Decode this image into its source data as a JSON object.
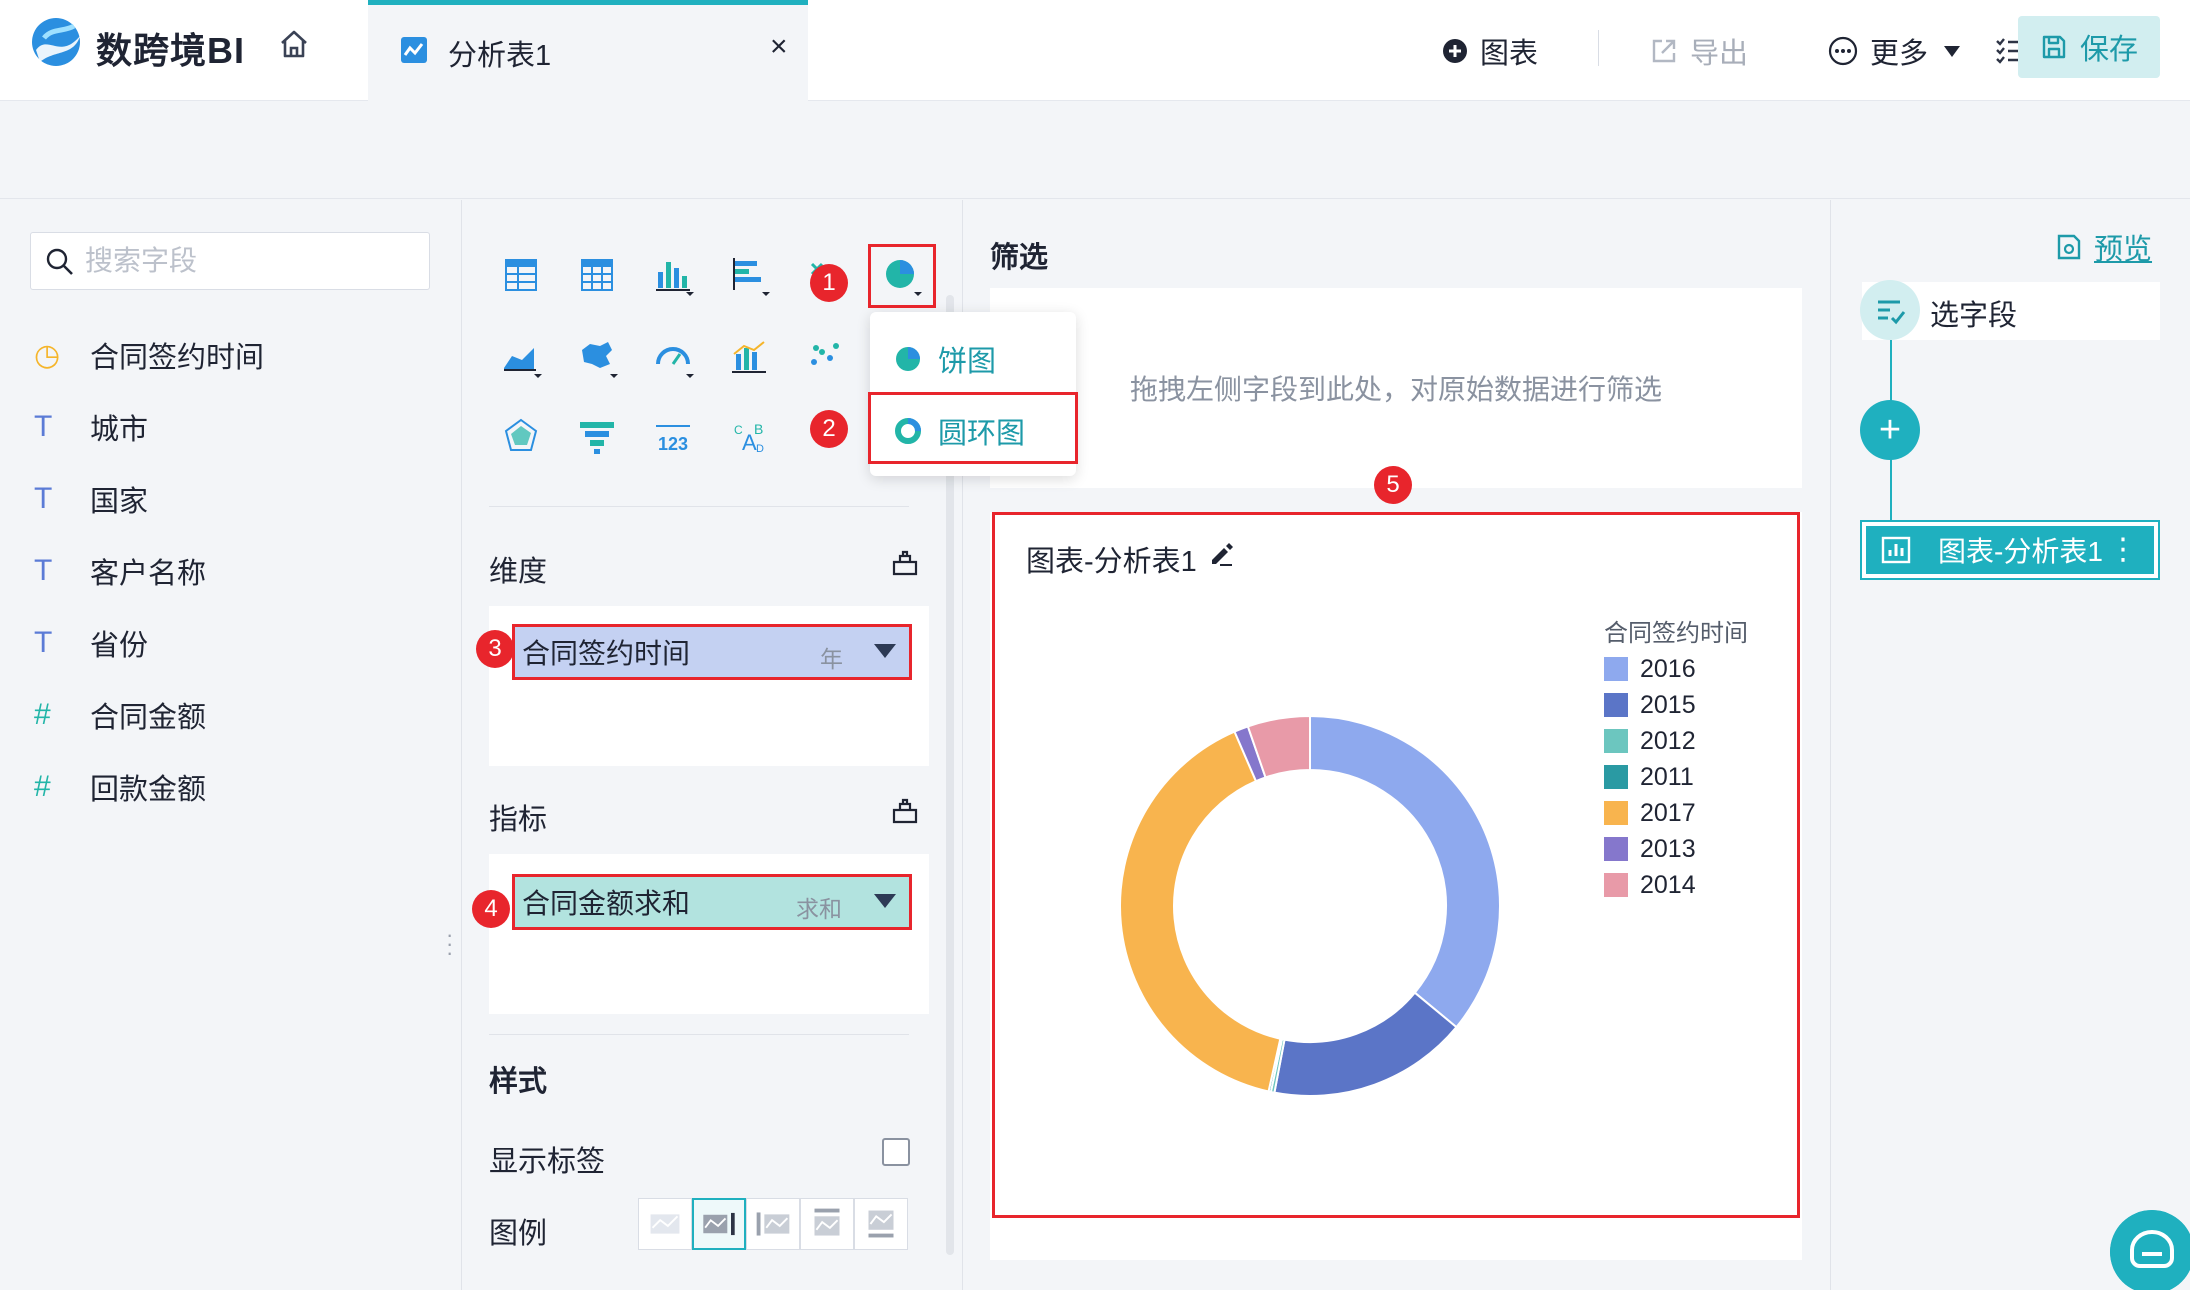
{
  "app": {
    "title": "数跨境BI"
  },
  "tabs": [
    {
      "label": "分析表1",
      "close": "×"
    }
  ],
  "toolbar": {
    "chart": "图表",
    "export": "导出",
    "more": "更多",
    "save": "保存"
  },
  "search": {
    "placeholder": "搜索字段"
  },
  "fields": [
    {
      "type": "time",
      "type_glyph": "◷",
      "label": "合同签约时间",
      "color": "#f5b52b"
    },
    {
      "type": "text",
      "type_glyph": "T",
      "label": "城市",
      "color": "#5b7bd6"
    },
    {
      "type": "text",
      "type_glyph": "T",
      "label": "国家",
      "color": "#5b7bd6"
    },
    {
      "type": "text",
      "type_glyph": "T",
      "label": "客户名称",
      "color": "#5b7bd6"
    },
    {
      "type": "text",
      "type_glyph": "T",
      "label": "省份",
      "color": "#5b7bd6"
    },
    {
      "type": "number",
      "type_glyph": "#",
      "label": "合同金额",
      "color": "#22b5a8"
    },
    {
      "type": "number",
      "type_glyph": "#",
      "label": "回款金额",
      "color": "#22b5a8"
    }
  ],
  "chart_dropdown": {
    "pie": "饼图",
    "donut": "圆环图"
  },
  "config": {
    "dimension_title": "维度",
    "dimension_field": {
      "label": "合同签约时间",
      "sub": "年",
      "color": "#c4d1f2"
    },
    "measure_title": "指标",
    "measure_field": {
      "label": "合同金额求和",
      "sub": "求和",
      "color": "#b2e3df"
    },
    "style_title": "样式",
    "show_label": "显示标签",
    "legend": "图例"
  },
  "badges": [
    "1",
    "2",
    "3",
    "4",
    "5"
  ],
  "filter": {
    "title": "筛选",
    "hint": "拖拽左侧字段到此处，对原始数据进行筛选"
  },
  "chart": {
    "card_title": "图表-分析表1"
  },
  "chart_data": {
    "type": "pie",
    "variant": "donut",
    "legend_title": "合同签约时间",
    "legend_position": "top-right",
    "categories": [
      "2016",
      "2015",
      "2012",
      "2011",
      "2017",
      "2013",
      "2014"
    ],
    "values": [
      36.0,
      17.0,
      0.3,
      0.2,
      40.0,
      1.2,
      5.3
    ],
    "colors": [
      "#8ea9ee",
      "#5b75c7",
      "#6cc6bf",
      "#2a9aa3",
      "#f8b44e",
      "#8577cc",
      "#e89aa8"
    ]
  },
  "right_panel": {
    "preview": "预览",
    "step": "选字段",
    "node": "图表-分析表1"
  }
}
